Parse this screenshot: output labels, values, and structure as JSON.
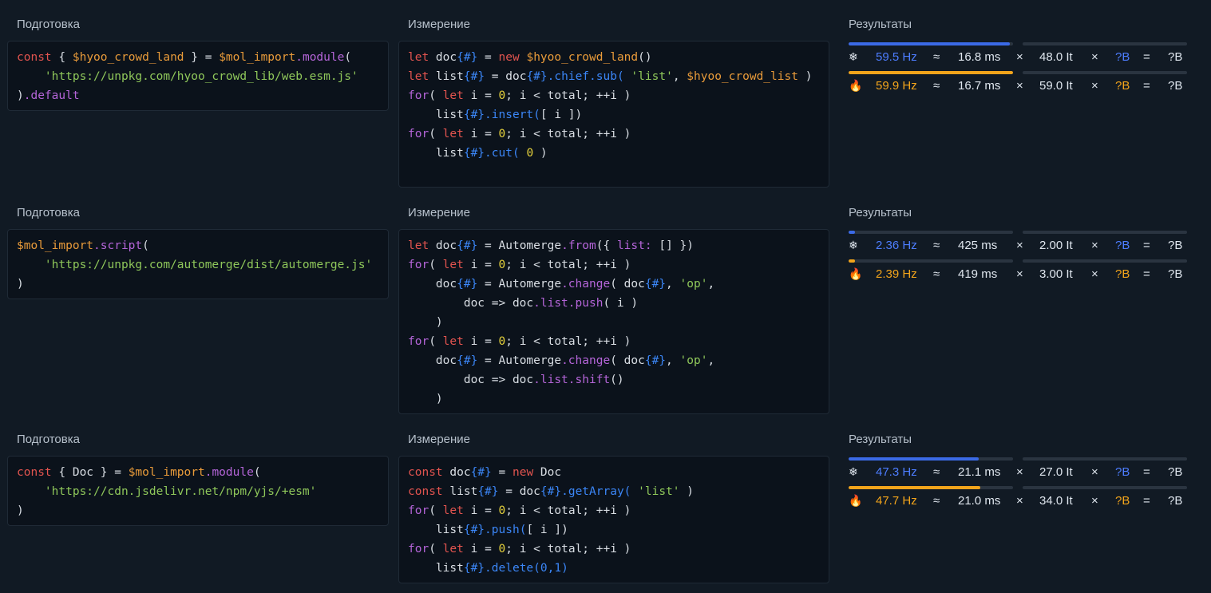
{
  "sections": [
    {
      "prep_label": "Подготовка",
      "measure_label": "Измерение",
      "results_label": "Результаты",
      "prep_lines": [
        [
          [
            "kw",
            "const"
          ],
          [
            "pl",
            " { "
          ],
          [
            "ob",
            "$hyoo_crowd_land"
          ],
          [
            "pl",
            " } = "
          ],
          [
            "ob",
            "$mol_import"
          ],
          [
            "fn",
            ".module"
          ],
          [
            "pl",
            "("
          ]
        ],
        [
          [
            "pl",
            "    "
          ],
          [
            "str",
            "'https://unpkg.com/hyoo_crowd_lib/web.esm.js'"
          ]
        ],
        [
          [
            "pl",
            ")"
          ],
          [
            "fn",
            ".default"
          ]
        ]
      ],
      "measure_lines": [
        [
          [
            "kw",
            "let"
          ],
          [
            "pl",
            " doc"
          ],
          [
            "ml",
            "{#}"
          ],
          [
            "pl",
            " = "
          ],
          [
            "kw",
            "new"
          ],
          [
            "pl",
            " "
          ],
          [
            "ob",
            "$hyoo_crowd_land"
          ],
          [
            "pl",
            "()"
          ]
        ],
        [
          [
            "kw",
            "let"
          ],
          [
            "pl",
            " list"
          ],
          [
            "ml",
            "{#}"
          ],
          [
            "pl",
            " = doc"
          ],
          [
            "ml",
            "{#}"
          ],
          [
            "ml",
            ".chief.sub("
          ],
          [
            "pl",
            " "
          ],
          [
            "str",
            "'list'"
          ],
          [
            "pl",
            ", "
          ],
          [
            "ob",
            "$hyoo_crowd_list"
          ],
          [
            "pl",
            " )"
          ]
        ],
        [
          [
            "fn",
            "for"
          ],
          [
            "pl",
            "( "
          ],
          [
            "kw",
            "let"
          ],
          [
            "pl",
            " i = "
          ],
          [
            "num",
            "0"
          ],
          [
            "pl",
            "; i < total; ++i )"
          ]
        ],
        [
          [
            "pl",
            "    list"
          ],
          [
            "ml",
            "{#}"
          ],
          [
            "ml",
            ".insert("
          ],
          [
            "pl",
            "[ i ])"
          ]
        ],
        [
          [
            "fn",
            "for"
          ],
          [
            "pl",
            "( "
          ],
          [
            "kw",
            "let"
          ],
          [
            "pl",
            " i = "
          ],
          [
            "num",
            "0"
          ],
          [
            "pl",
            "; i < total; ++i )"
          ]
        ],
        [
          [
            "pl",
            "    list"
          ],
          [
            "ml",
            "{#}"
          ],
          [
            "ml",
            ".cut("
          ],
          [
            "pl",
            " "
          ],
          [
            "num",
            "0"
          ],
          [
            "pl",
            " )"
          ]
        ]
      ],
      "results": [
        {
          "icon": "❄",
          "hz": "59.5 Hz",
          "approx": "≈",
          "ms": "16.8 ms",
          "times1": "×",
          "it": "48.0 It",
          "times2": "×",
          "b": "?B",
          "eq": "=",
          "total": "?B",
          "bar": 0.98,
          "kind": "cold"
        },
        {
          "icon": "🔥",
          "hz": "59.9 Hz",
          "approx": "≈",
          "ms": "16.7 ms",
          "times1": "×",
          "it": "59.0 It",
          "times2": "×",
          "b": "?B",
          "eq": "=",
          "total": "?B",
          "bar": 1.0,
          "kind": "hot"
        }
      ]
    },
    {
      "prep_label": "Подготовка",
      "measure_label": "Измерение",
      "results_label": "Результаты",
      "prep_lines": [
        [
          [
            "ob",
            "$mol_import"
          ],
          [
            "fn",
            ".script"
          ],
          [
            "pl",
            "("
          ]
        ],
        [
          [
            "pl",
            "    "
          ],
          [
            "str",
            "'https://unpkg.com/automerge/dist/automerge.js'"
          ]
        ],
        [
          [
            "pl",
            ")"
          ]
        ]
      ],
      "measure_lines": [
        [
          [
            "kw",
            "let"
          ],
          [
            "pl",
            " doc"
          ],
          [
            "ml",
            "{#}"
          ],
          [
            "pl",
            " = Automerge"
          ],
          [
            "fn",
            ".from"
          ],
          [
            "pl",
            "({ "
          ],
          [
            "fn",
            "list:"
          ],
          [
            "pl",
            " [] })"
          ]
        ],
        [
          [
            "fn",
            "for"
          ],
          [
            "pl",
            "( "
          ],
          [
            "kw",
            "let"
          ],
          [
            "pl",
            " i = "
          ],
          [
            "num",
            "0"
          ],
          [
            "pl",
            "; i < total; ++i )"
          ]
        ],
        [
          [
            "pl",
            "    doc"
          ],
          [
            "ml",
            "{#}"
          ],
          [
            "pl",
            " = Automerge"
          ],
          [
            "fn",
            ".change"
          ],
          [
            "pl",
            "( doc"
          ],
          [
            "ml",
            "{#}"
          ],
          [
            "pl",
            ", "
          ],
          [
            "str",
            "'op'"
          ],
          [
            "pl",
            ","
          ]
        ],
        [
          [
            "pl",
            "        doc => doc"
          ],
          [
            "fn",
            ".list.push"
          ],
          [
            "pl",
            "( i )"
          ]
        ],
        [
          [
            "pl",
            "    )"
          ]
        ],
        [
          [
            "fn",
            "for"
          ],
          [
            "pl",
            "( "
          ],
          [
            "kw",
            "let"
          ],
          [
            "pl",
            " i = "
          ],
          [
            "num",
            "0"
          ],
          [
            "pl",
            "; i < total; ++i )"
          ]
        ],
        [
          [
            "pl",
            "    doc"
          ],
          [
            "ml",
            "{#}"
          ],
          [
            "pl",
            " = Automerge"
          ],
          [
            "fn",
            ".change"
          ],
          [
            "pl",
            "( doc"
          ],
          [
            "ml",
            "{#}"
          ],
          [
            "pl",
            ", "
          ],
          [
            "str",
            "'op'"
          ],
          [
            "pl",
            ","
          ]
        ],
        [
          [
            "pl",
            "        doc => doc"
          ],
          [
            "fn",
            ".list.shift"
          ],
          [
            "pl",
            "()"
          ]
        ],
        [
          [
            "pl",
            "    )"
          ]
        ]
      ],
      "results": [
        {
          "icon": "❄",
          "hz": "2.36 Hz",
          "approx": "≈",
          "ms": "425 ms",
          "times1": "×",
          "it": "2.00 It",
          "times2": "×",
          "b": "?B",
          "eq": "=",
          "total": "?B",
          "bar": 0.04,
          "kind": "cold"
        },
        {
          "icon": "🔥",
          "hz": "2.39 Hz",
          "approx": "≈",
          "ms": "419 ms",
          "times1": "×",
          "it": "3.00 It",
          "times2": "×",
          "b": "?B",
          "eq": "=",
          "total": "?B",
          "bar": 0.04,
          "kind": "hot"
        }
      ]
    },
    {
      "prep_label": "Подготовка",
      "measure_label": "Измерение",
      "results_label": "Результаты",
      "prep_lines": [
        [
          [
            "kw",
            "const"
          ],
          [
            "pl",
            " { Doc } = "
          ],
          [
            "ob",
            "$mol_import"
          ],
          [
            "fn",
            ".module"
          ],
          [
            "pl",
            "("
          ]
        ],
        [
          [
            "pl",
            "    "
          ],
          [
            "str",
            "'https://cdn.jsdelivr.net/npm/yjs/+esm'"
          ]
        ],
        [
          [
            "pl",
            ")"
          ]
        ]
      ],
      "measure_lines": [
        [
          [
            "kw",
            "const"
          ],
          [
            "pl",
            " doc"
          ],
          [
            "ml",
            "{#}"
          ],
          [
            "pl",
            " = "
          ],
          [
            "kw",
            "new"
          ],
          [
            "pl",
            " Doc"
          ]
        ],
        [
          [
            "kw",
            "const"
          ],
          [
            "pl",
            " list"
          ],
          [
            "ml",
            "{#}"
          ],
          [
            "pl",
            " = doc"
          ],
          [
            "ml",
            "{#}"
          ],
          [
            "ml",
            ".getArray("
          ],
          [
            "pl",
            " "
          ],
          [
            "str",
            "'list'"
          ],
          [
            "pl",
            " )"
          ]
        ],
        [
          [
            "fn",
            "for"
          ],
          [
            "pl",
            "( "
          ],
          [
            "kw",
            "let"
          ],
          [
            "pl",
            " i = "
          ],
          [
            "num",
            "0"
          ],
          [
            "pl",
            "; i < total; ++i )"
          ]
        ],
        [
          [
            "pl",
            "    list"
          ],
          [
            "ml",
            "{#}"
          ],
          [
            "ml",
            ".push("
          ],
          [
            "pl",
            "[ i ])"
          ]
        ],
        [
          [
            "fn",
            "for"
          ],
          [
            "pl",
            "( "
          ],
          [
            "kw",
            "let"
          ],
          [
            "pl",
            " i = "
          ],
          [
            "num",
            "0"
          ],
          [
            "pl",
            "; i < total; ++i )"
          ]
        ],
        [
          [
            "pl",
            "    list"
          ],
          [
            "ml",
            "{#}"
          ],
          [
            "ml",
            ".delete(0,1)"
          ]
        ]
      ],
      "results": [
        {
          "icon": "❄",
          "hz": "47.3 Hz",
          "approx": "≈",
          "ms": "21.1 ms",
          "times1": "×",
          "it": "27.0 It",
          "times2": "×",
          "b": "?B",
          "eq": "=",
          "total": "?B",
          "bar": 0.79,
          "kind": "cold"
        },
        {
          "icon": "🔥",
          "hz": "47.7 Hz",
          "approx": "≈",
          "ms": "21.0 ms",
          "times1": "×",
          "it": "34.0 It",
          "times2": "×",
          "b": "?B",
          "eq": "=",
          "total": "?B",
          "bar": 0.8,
          "kind": "hot"
        }
      ]
    }
  ]
}
